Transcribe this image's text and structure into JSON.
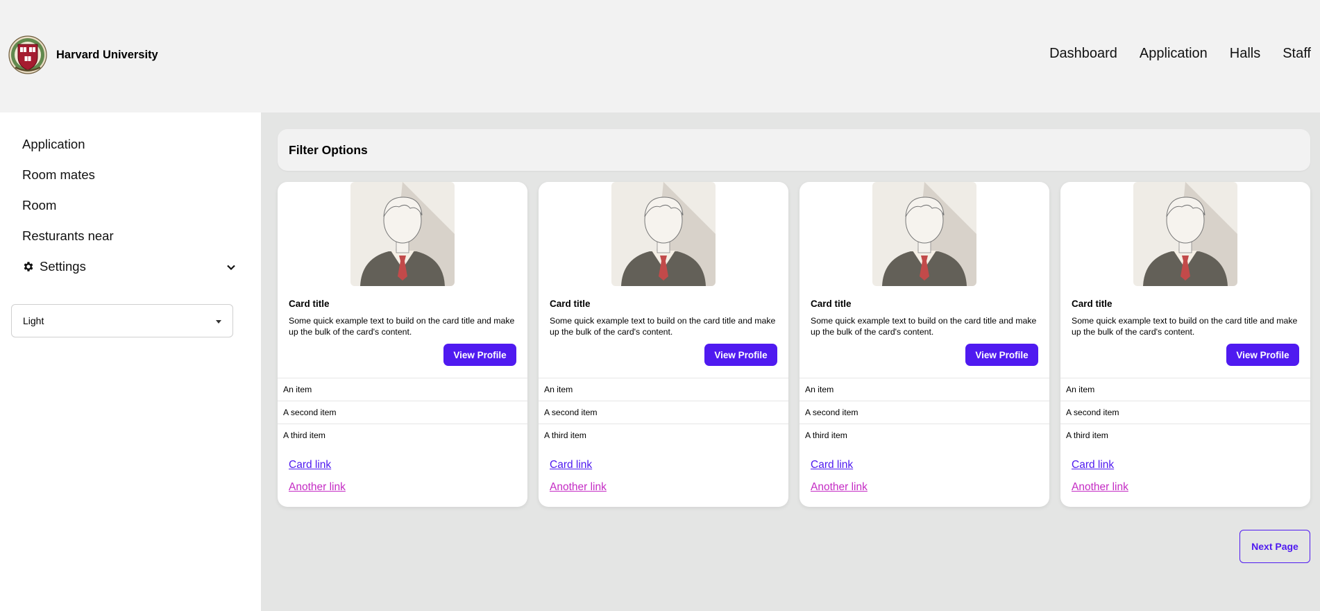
{
  "header": {
    "brand_name": "Harvard University",
    "logo_icon": "harvard-shield-logo",
    "nav": [
      "Dashboard",
      "Application",
      "Halls",
      "Staff"
    ]
  },
  "sidebar": {
    "items": [
      "Application",
      "Room mates",
      "Room",
      "Resturants near"
    ],
    "settings_label": "Settings",
    "settings_icon": "gear-icon",
    "theme_select_value": "Light"
  },
  "main": {
    "filter_label": "Filter Options",
    "cards": [
      {
        "title": "Card title",
        "text": "Some quick example text to build on the card title and make up the bulk of the card's content.",
        "button": "View Profile",
        "items": [
          "An item",
          "A second item",
          "A third item"
        ],
        "link1": "Card link",
        "link2": "Another link"
      },
      {
        "title": "Card title",
        "text": "Some quick example text to build on the card title and make up the bulk of the card's content.",
        "button": "View Profile",
        "items": [
          "An item",
          "A second item",
          "A third item"
        ],
        "link1": "Card link",
        "link2": "Another link"
      },
      {
        "title": "Card title",
        "text": "Some quick example text to build on the card title and make up the bulk of the card's content.",
        "button": "View Profile",
        "items": [
          "An item",
          "A second item",
          "A third item"
        ],
        "link1": "Card link",
        "link2": "Another link"
      },
      {
        "title": "Card title",
        "text": "Some quick example text to build on the card title and make up the bulk of the card's content.",
        "button": "View Profile",
        "items": [
          "An item",
          "A second item",
          "A third item"
        ],
        "link1": "Card link",
        "link2": "Another link"
      }
    ],
    "next_button": "Next Page"
  },
  "colors": {
    "accent": "#4f1af0",
    "link_secondary": "#c42bc4",
    "header_bg": "#f2f2f2",
    "main_bg": "#e4e5e4"
  }
}
